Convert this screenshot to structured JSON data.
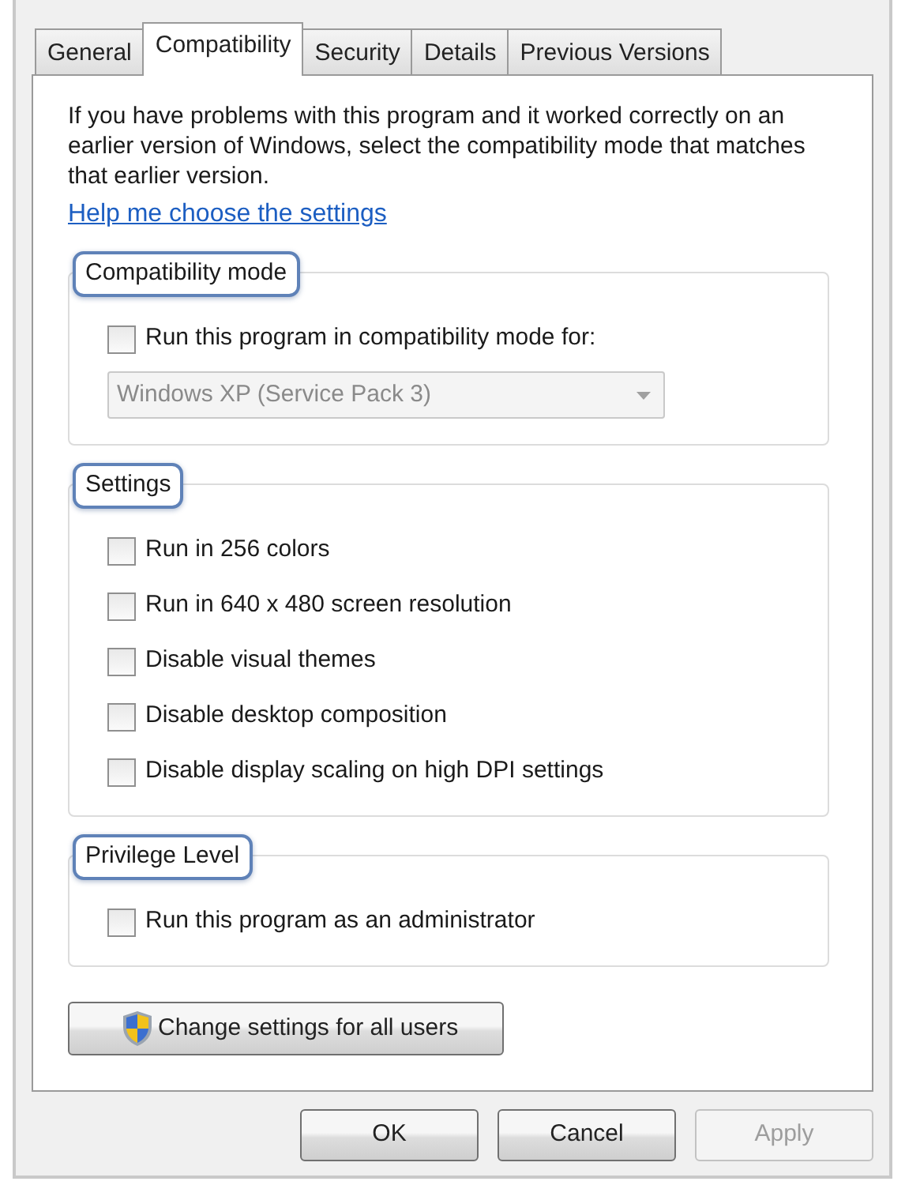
{
  "tabs": [
    {
      "label": "General",
      "selected": false
    },
    {
      "label": "Compatibility",
      "selected": true
    },
    {
      "label": "Security",
      "selected": false
    },
    {
      "label": "Details",
      "selected": false
    },
    {
      "label": "Previous Versions",
      "selected": false
    }
  ],
  "description": "If you have problems with this program and it worked correctly on an earlier version of Windows, select the compatibility mode that matches that earlier version.",
  "help_link": "Help me choose the settings",
  "groups": [
    {
      "title": "Compatibility mode",
      "highlighted": true,
      "items": [
        {
          "kind": "checkbox",
          "label": "Run this program in compatibility mode for:",
          "checked": false
        },
        {
          "kind": "dropdown",
          "value": "Windows XP (Service Pack 3)",
          "disabled": true
        }
      ]
    },
    {
      "title": "Settings",
      "highlighted": true,
      "items": [
        {
          "kind": "checkbox",
          "label": "Run in 256 colors",
          "checked": false
        },
        {
          "kind": "checkbox",
          "label": "Run in 640 x 480 screen resolution",
          "checked": false
        },
        {
          "kind": "checkbox",
          "label": "Disable visual themes",
          "checked": false
        },
        {
          "kind": "checkbox",
          "label": "Disable desktop composition",
          "checked": false
        },
        {
          "kind": "checkbox",
          "label": "Disable display scaling on high DPI settings",
          "checked": false
        }
      ]
    },
    {
      "title": "Privilege Level",
      "highlighted": true,
      "items": [
        {
          "kind": "checkbox",
          "label": "Run this program as an administrator",
          "checked": false
        }
      ]
    }
  ],
  "shield_button": {
    "label": "Change settings for all users"
  },
  "buttons": [
    {
      "label": "OK",
      "disabled": false
    },
    {
      "label": "Cancel",
      "disabled": false
    },
    {
      "label": "Apply",
      "disabled": true
    }
  ]
}
